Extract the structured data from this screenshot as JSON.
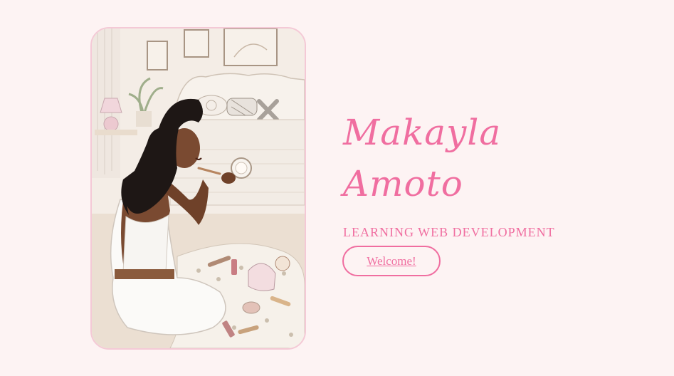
{
  "hero": {
    "first_name": "Makayla",
    "last_name": "Amoto",
    "subtitle": "LEARNING WEB DEVELOPMENT",
    "welcome_label": "Welcome!"
  },
  "colors": {
    "background": "#fdf3f3",
    "accent": "#f06ea0",
    "card_border": "#f4c9d6"
  },
  "illustration": {
    "icon": "woman-applying-makeup-illustration"
  }
}
